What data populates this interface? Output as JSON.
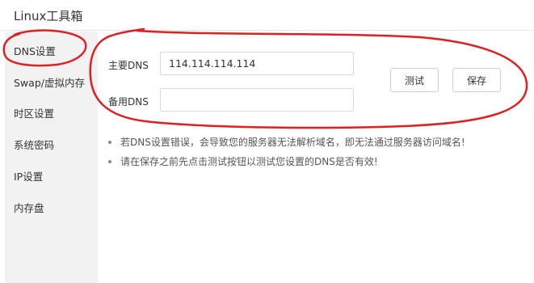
{
  "app": {
    "title": "Linux工具箱"
  },
  "sidebar": {
    "items": [
      {
        "label": "DNS设置",
        "active": true
      },
      {
        "label": "Swap/虚拟内存"
      },
      {
        "label": "时区设置"
      },
      {
        "label": "系统密码"
      },
      {
        "label": "IP设置"
      },
      {
        "label": "内存盘"
      }
    ]
  },
  "dns": {
    "primary_label": "主要DNS",
    "primary_value": "114.114.114.114",
    "secondary_label": "备用DNS",
    "secondary_value": "",
    "test_button": "测试",
    "save_button": "保存"
  },
  "notes": [
    "若DNS设置错误，会导致您的服务器无法解析域名，即无法通过服务器访问域名!",
    "请在保存之前先点击测试按钮以测试您设置的DNS是否有效!"
  ],
  "annotation": {
    "stroke_color": "#e02020"
  }
}
